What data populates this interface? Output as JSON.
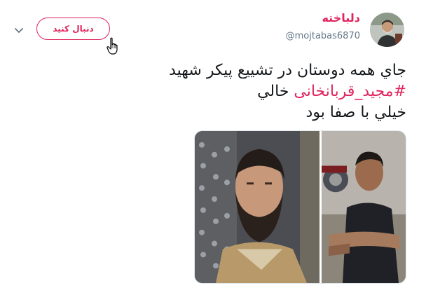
{
  "header": {
    "display_name": "دلباخته",
    "username": "@mojtabas6870",
    "follow_label": "دنبال کنید"
  },
  "tweet": {
    "line1": "جاي همه دوستان در تشييع پيکر شهيد",
    "hashtag": "#مجيد_قربانخانی",
    "line2_rest": " خالي",
    "line3": "خيلي با صفا بود"
  },
  "icons": [
    "chevron-down-icon",
    "hand-pointer-cursor-icon",
    "avatar"
  ],
  "colors": {
    "accent": "#e0245e",
    "muted": "#657786",
    "text": "#14171a"
  }
}
